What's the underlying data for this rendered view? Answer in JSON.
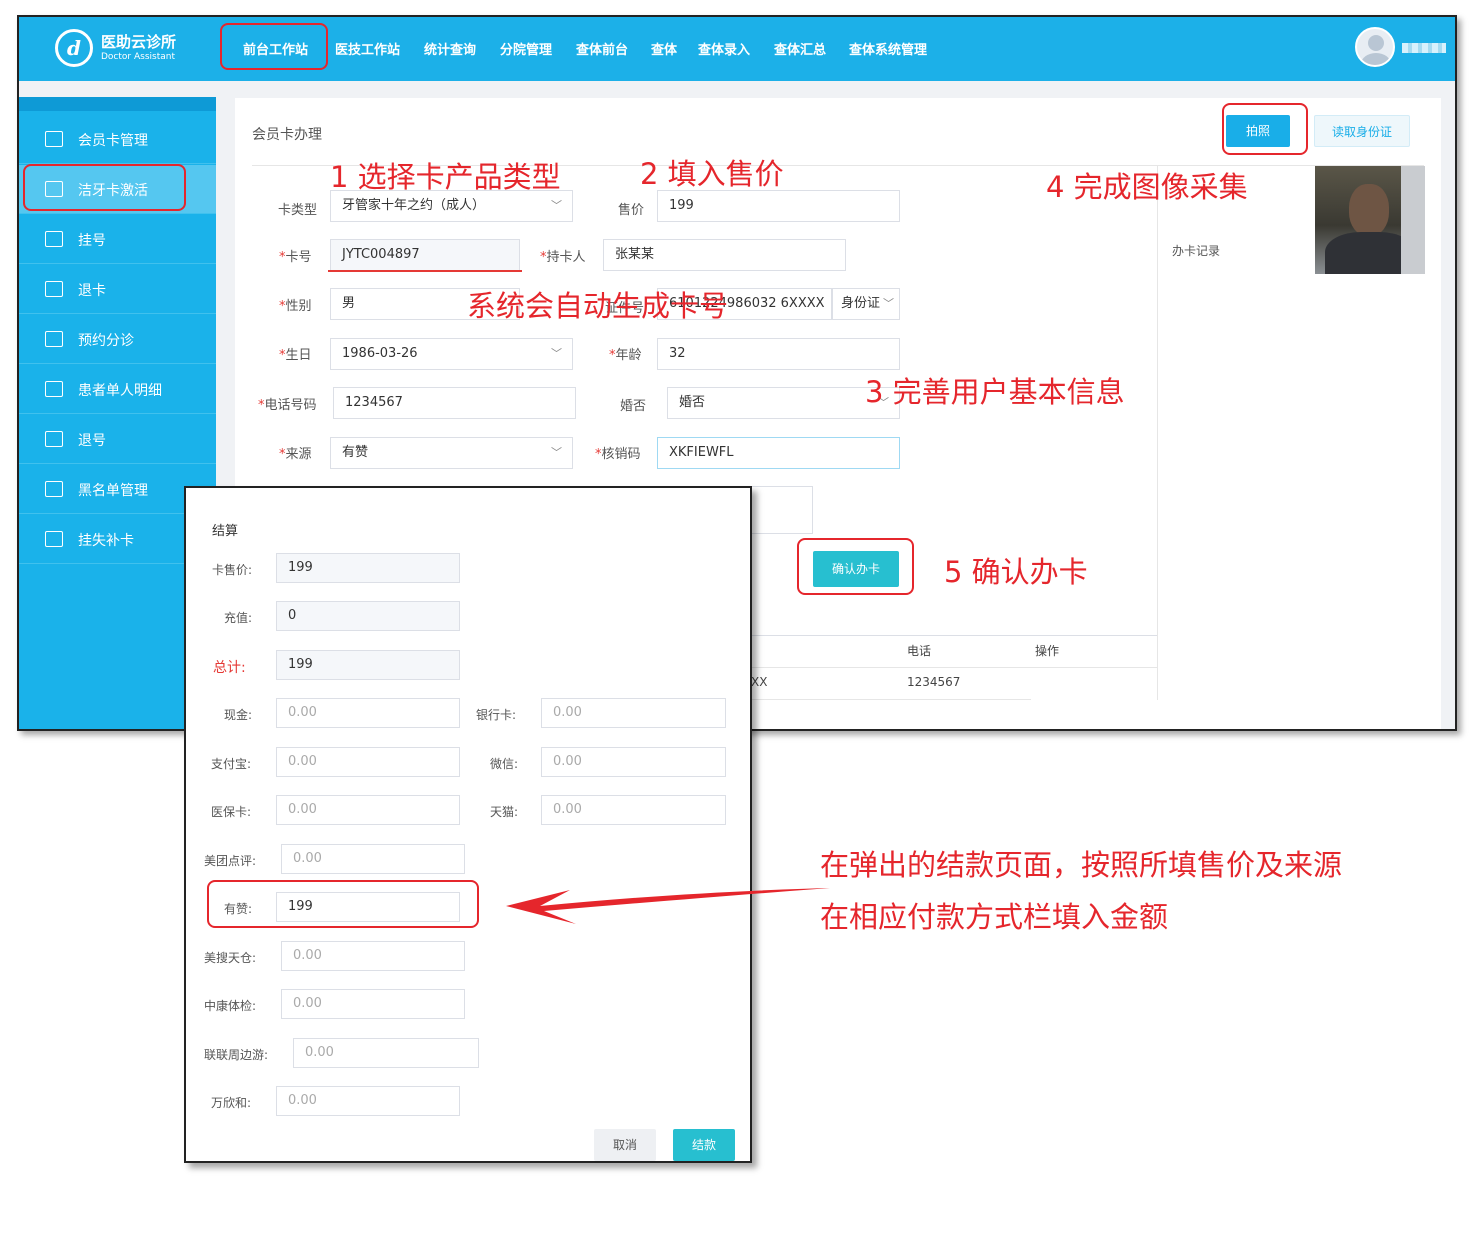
{
  "app": {
    "logo_glyph": "d",
    "brand_cn": "医助云诊所",
    "brand_en": "Doctor Assistant"
  },
  "nav": {
    "items": [
      "前台工作站",
      "医技工作站",
      "统计查询",
      "分院管理",
      "查体前台",
      "查体",
      "查体录入",
      "查体汇总",
      "查体系统管理"
    ]
  },
  "sidebar": {
    "items": [
      {
        "label": "会员卡管理",
        "icon": "card-icon"
      },
      {
        "label": "洁牙卡激活",
        "icon": "activate-icon"
      },
      {
        "label": "挂号",
        "icon": "register-icon"
      },
      {
        "label": "退卡",
        "icon": "return-card-icon"
      },
      {
        "label": "预约分诊",
        "icon": "calendar-icon"
      },
      {
        "label": "患者单人明细",
        "icon": "document-icon"
      },
      {
        "label": "退号",
        "icon": "star-icon"
      },
      {
        "label": "黑名单管理",
        "icon": "blacklist-icon"
      },
      {
        "label": "挂失补卡",
        "icon": "check-card-icon"
      }
    ]
  },
  "page": {
    "title": "会员卡办理",
    "photo_button": "拍照",
    "read_id_button": "读取身份证",
    "record_label": "办卡记录",
    "confirm_button": "确认办卡"
  },
  "form": {
    "card_type_label": "卡类型",
    "card_type_value": "牙管家十年之约（成人）",
    "price_label": "售价",
    "price_value": "199",
    "card_no_label": "卡号",
    "card_no_value": "JYTC004897",
    "holder_label": "持卡人",
    "holder_value": "张某某",
    "gender_label": "性别",
    "gender_value": "男",
    "id_label": "证件号",
    "id_value": "6101224986032 6XXXX",
    "id_type_value": "身份证",
    "birthday_label": "生日",
    "birthday_value": "1986-03-26",
    "age_label": "年龄",
    "age_value": "32",
    "phone_label": "电话号码",
    "phone_value": "1234567",
    "marital_label": "婚否",
    "marital_value": "婚否",
    "source_label": "来源",
    "source_value": "有赞",
    "verify_label": "核销码",
    "verify_value": "XKFIEWFL",
    "required_mark": "*"
  },
  "table": {
    "col_phone": "电话",
    "col_action": "操作",
    "row_fragment": "XX",
    "row_phone": "1234567"
  },
  "modal": {
    "title": "结算",
    "card_price_label": "卡售价:",
    "card_price_value": "199",
    "recharge_label": "充值:",
    "recharge_value": "0",
    "total_label": "总计:",
    "total_value": "199",
    "cash_label": "现金:",
    "cash_value": "0.00",
    "bankcard_label": "银行卡:",
    "bankcard_value": "0.00",
    "alipay_label": "支付宝:",
    "alipay_value": "0.00",
    "wechat_label": "微信:",
    "wechat_value": "0.00",
    "insurance_label": "医保卡:",
    "insurance_value": "0.00",
    "tmall_label": "天猫:",
    "tmall_value": "0.00",
    "meituan_label": "美团点评:",
    "meituan_value": "0.00",
    "youzan_label": "有赞:",
    "youzan_value": "199",
    "meisou_label": "美搜天仓:",
    "meisou_value": "0.00",
    "zhongkang_label": "中康体检:",
    "zhongkang_value": "0.00",
    "lianlian_label": "联联周边游:",
    "lianlian_value": "0.00",
    "wanxinhe_label": "万欣和:",
    "wanxinhe_value": "0.00",
    "cancel_button": "取消",
    "pay_button": "结款"
  },
  "annotations": {
    "step1": "1 选择卡产品类型",
    "step2": "2 填入售价",
    "step3": "3 完善用户基本信息",
    "step4": "4 完成图像采集",
    "step5": "5 确认办卡",
    "auto_card_no": "系统会自动生成卡号",
    "payment_note_line1": "在弹出的结款页面，按照所填售价及来源",
    "payment_note_line2": "在相应付款方式栏填入金额"
  },
  "colors": {
    "brand": "#1cb0e8",
    "annotation_red": "#e5262c",
    "confirm_button": "#27bfd0"
  }
}
